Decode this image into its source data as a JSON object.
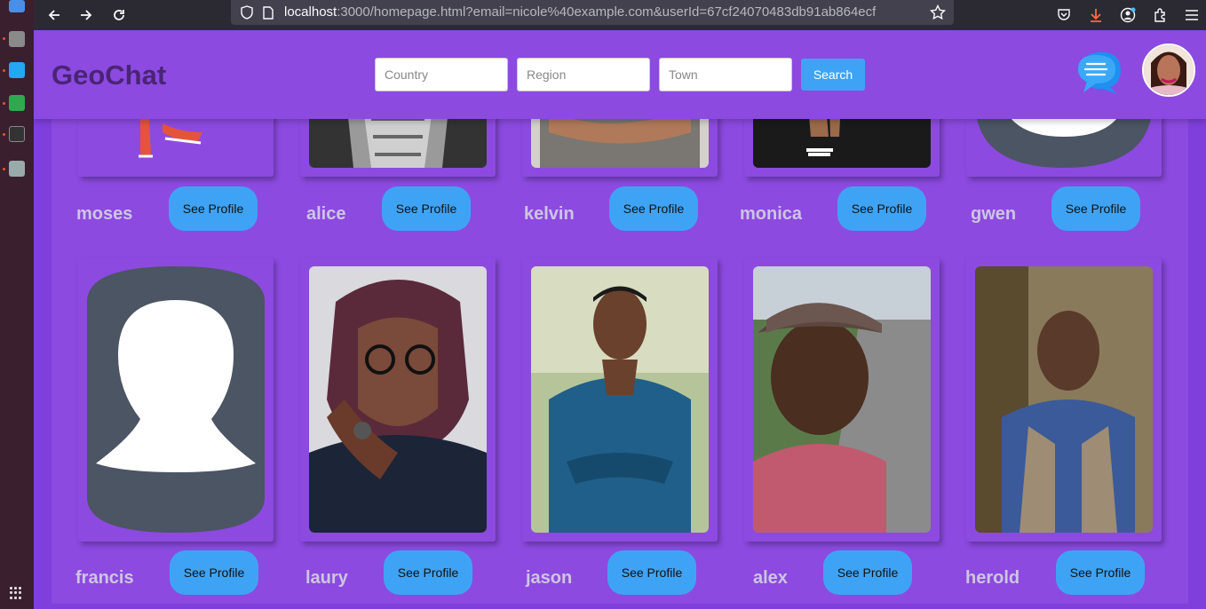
{
  "browser": {
    "url_host": "localhost",
    "url_rest": ":3000/homepage.html?email=nicole%40example.com&userId=67cf24070483db91ab864ecf"
  },
  "header": {
    "logo": "GeoChat",
    "country_placeholder": "Country",
    "region_placeholder": "Region",
    "town_placeholder": "Town",
    "search_label": "Search"
  },
  "users": [
    {
      "name": "moses",
      "button": "See Profile"
    },
    {
      "name": "alice",
      "button": "See Profile"
    },
    {
      "name": "kelvin",
      "button": "See Profile"
    },
    {
      "name": "monica",
      "button": "See Profile"
    },
    {
      "name": "gwen",
      "button": "See Profile"
    },
    {
      "name": "francis",
      "button": "See Profile"
    },
    {
      "name": "laury",
      "button": "See Profile"
    },
    {
      "name": "jason",
      "button": "See Profile"
    },
    {
      "name": "alex",
      "button": "See Profile"
    },
    {
      "name": "herold",
      "button": "See Profile"
    }
  ],
  "colors": {
    "page_bg": "#7f3fdc",
    "header_bg": "#8c4ae0",
    "accent_blue": "#3fa3f5",
    "logo_color": "#4a2475"
  },
  "icons": [
    "back-arrow-icon",
    "forward-arrow-icon",
    "reload-icon",
    "shield-icon",
    "page-icon",
    "bookmark-star-icon",
    "pocket-icon",
    "download-icon",
    "account-icon",
    "extensions-icon",
    "menu-icon",
    "chat-bubble-icon"
  ]
}
